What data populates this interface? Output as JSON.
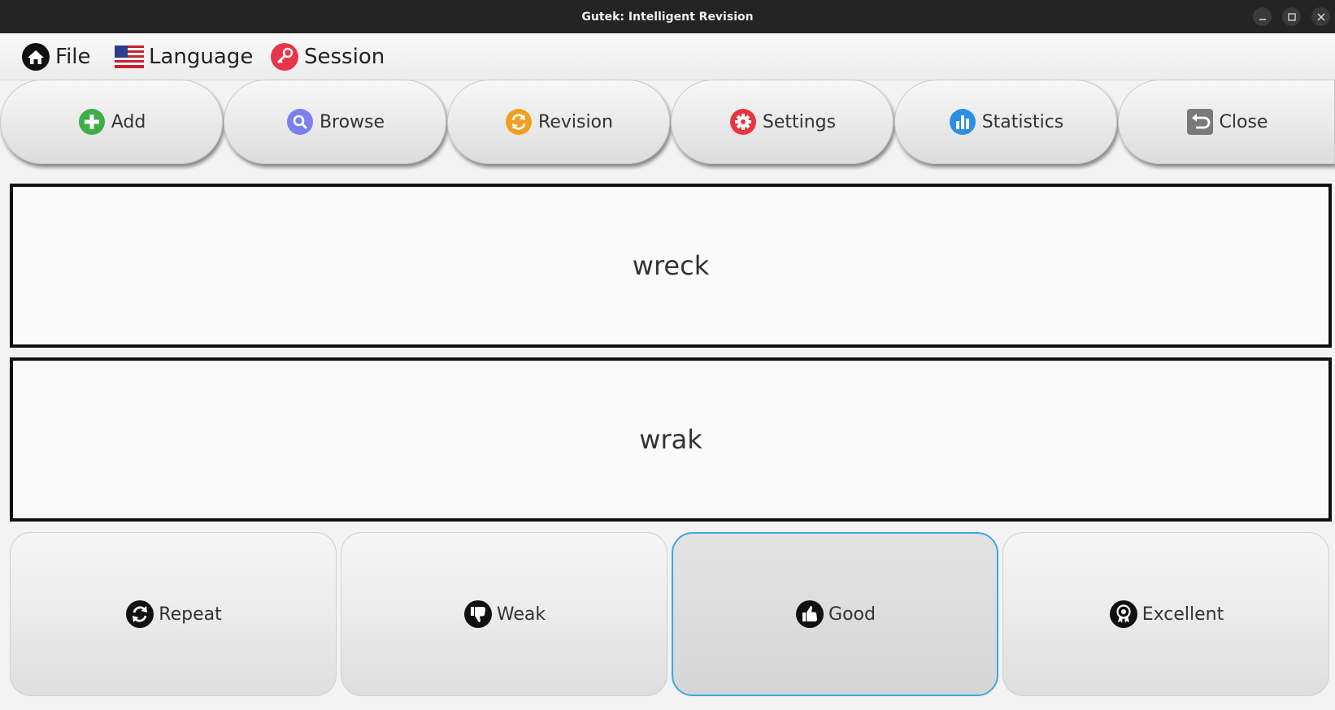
{
  "window": {
    "title": "Gutek: Intelligent Revision",
    "controls": [
      "minimize-icon",
      "maximize-icon",
      "close-window-icon"
    ]
  },
  "menu": {
    "items": [
      {
        "label": "File",
        "icon": "home-icon"
      },
      {
        "label": "Language",
        "icon": "us-flag-icon"
      },
      {
        "label": "Session",
        "icon": "key-icon"
      }
    ]
  },
  "toolbar": {
    "buttons": [
      {
        "label": "Add",
        "icon": "plus-icon",
        "color": "#3fae49"
      },
      {
        "label": "Browse",
        "icon": "search-icon",
        "color": "#7b7ff0"
      },
      {
        "label": "Revision",
        "icon": "refresh-icon",
        "color": "#f0a020"
      },
      {
        "label": "Settings",
        "icon": "gear-icon",
        "color": "#e8353f"
      },
      {
        "label": "Statistics",
        "icon": "bar-chart-icon",
        "color": "#2a8fe6"
      },
      {
        "label": "Close",
        "icon": "undo-icon",
        "color": "#7a7a7a"
      }
    ]
  },
  "card": {
    "question": "wreck",
    "answer": "wrak"
  },
  "answers": {
    "buttons": [
      {
        "label": "Repeat",
        "icon": "repeat-icon"
      },
      {
        "label": "Weak",
        "icon": "thumbs-down-icon"
      },
      {
        "label": "Good",
        "icon": "thumbs-up-icon",
        "focused": true
      },
      {
        "label": "Excellent",
        "icon": "award-icon"
      }
    ]
  },
  "colors": {
    "focus_border": "#3aa9de",
    "titlebar": "#242424"
  }
}
